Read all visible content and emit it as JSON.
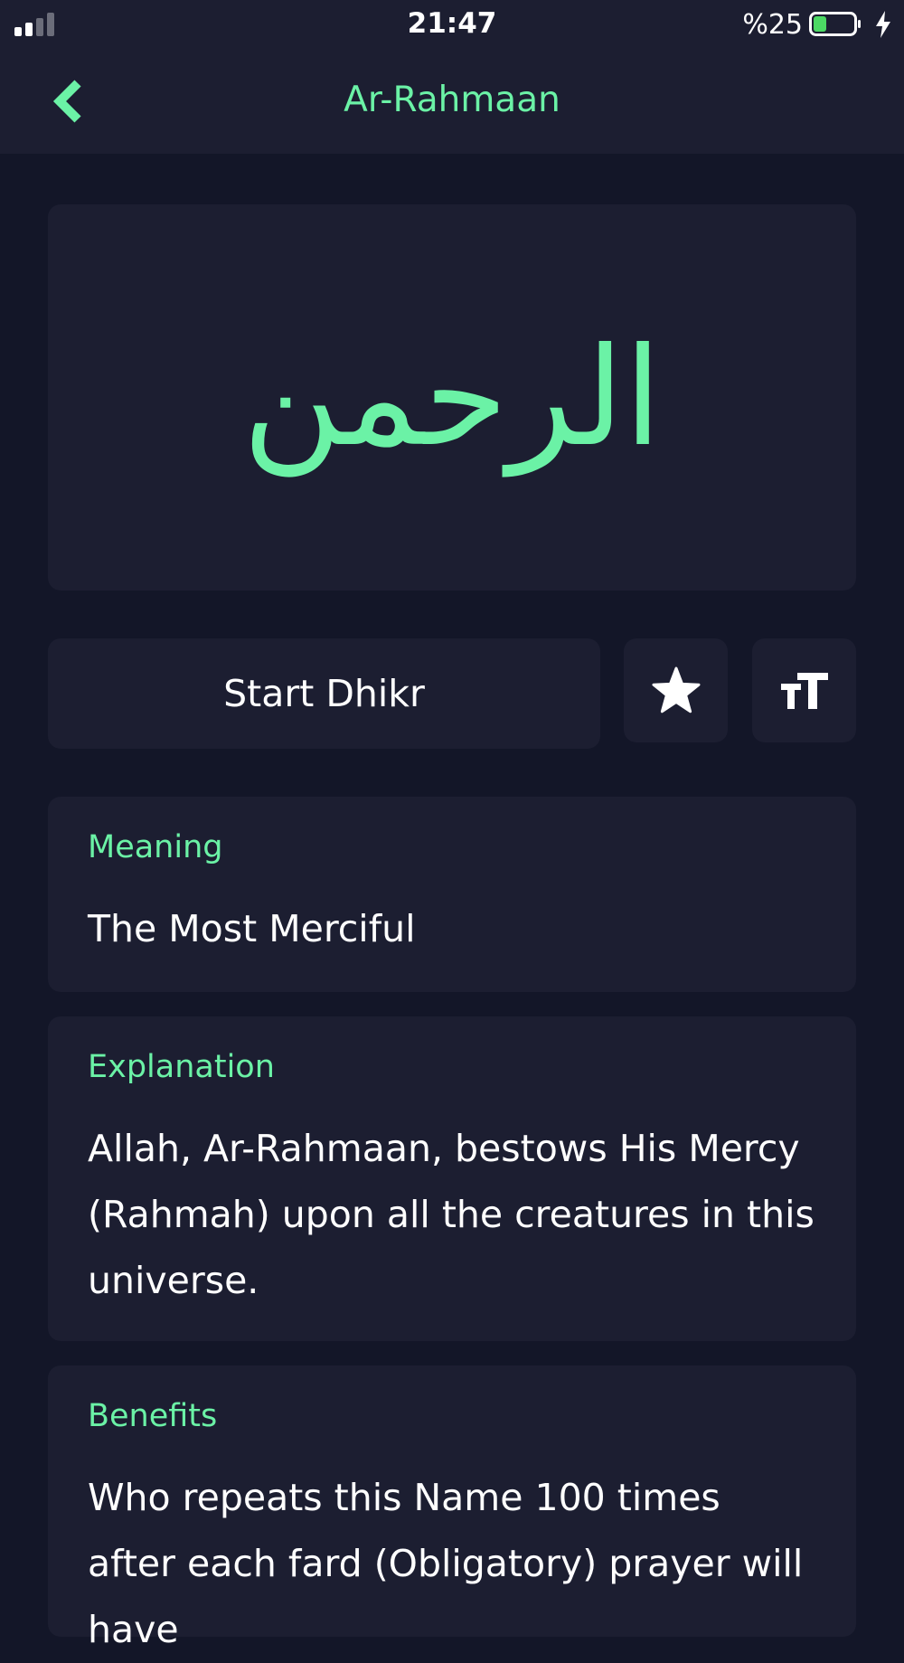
{
  "status_bar": {
    "time": "21:47",
    "battery_percent_text": "%25",
    "battery_level": 0.25,
    "signal_bars_filled": 2,
    "signal_bars_total": 4
  },
  "nav": {
    "title": "Ar-Rahmaan",
    "back_icon": "chevron-left-icon"
  },
  "name": {
    "arabic": "الرحمن"
  },
  "actions": {
    "start_dhikr_label": "Start Dhikr",
    "favorite_icon": "star-icon",
    "font_size_icon": "text-size-icon"
  },
  "meaning": {
    "label": "Meaning",
    "text": "The Most Merciful"
  },
  "explanation": {
    "label": "Explanation",
    "text": "Allah, Ar-Rahmaan, bestows His Mercy (Rahmah) upon all the creatures in this universe."
  },
  "benefits": {
    "label": "Benefits",
    "text": "Who repeats this Name 100 times after each fard (Obligatory) prayer will have"
  },
  "colors": {
    "accent": "#6bf2a6",
    "background": "#131628",
    "card": "#1c1e31",
    "text": "#ffffff"
  }
}
